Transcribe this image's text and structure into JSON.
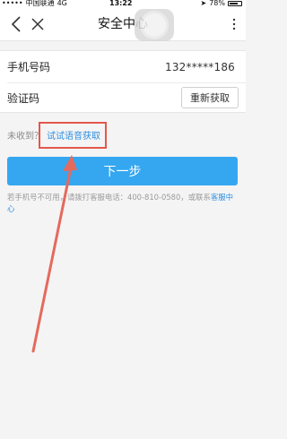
{
  "status_bar": {
    "carrier": "中国联通",
    "network": "4G",
    "time": "13:22",
    "battery": "78%"
  },
  "nav": {
    "title": "安全中心"
  },
  "form": {
    "phone_label": "手机号码",
    "phone_value": "132*****186",
    "code_label": "验证码",
    "resend_label": "重新获取"
  },
  "voice": {
    "prefix": "未收到？",
    "link": "试试语音获取"
  },
  "primary_button": "下一步",
  "help": {
    "text": "若手机号不可用，请拨打客服电话：400-810-0580，或联系",
    "link": "客服中心"
  },
  "colors": {
    "accent": "#35a7f0",
    "link": "#2f8fe0",
    "annotation": "#e4574c"
  }
}
